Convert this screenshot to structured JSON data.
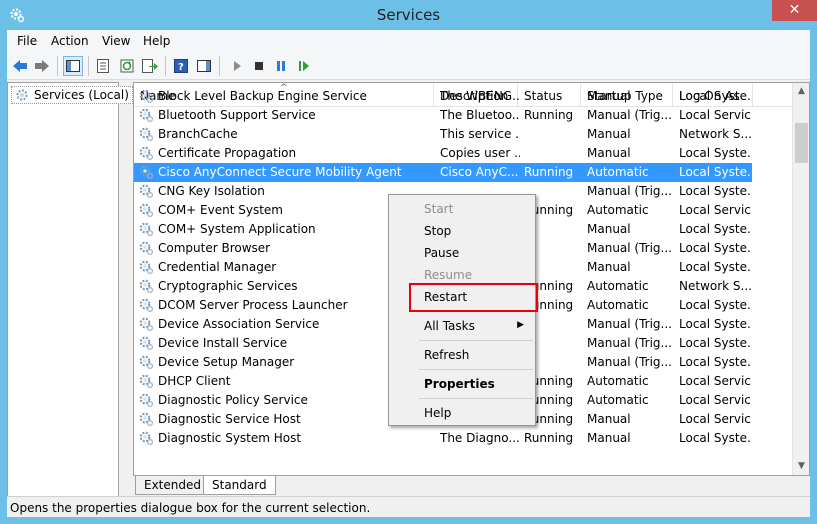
{
  "window": {
    "title": "Services",
    "close_glyph": "✕"
  },
  "menu": [
    "File",
    "Action",
    "View",
    "Help"
  ],
  "toolbar_icons": [
    "back-icon",
    "forward-icon",
    "console-tree-icon",
    "properties-icon",
    "refresh-icon",
    "export-icon",
    "help-icon",
    "show-pane-icon",
    "start-icon",
    "stop-icon",
    "pause-icon",
    "resume-icon"
  ],
  "tree": {
    "root_label": "Services (Local)"
  },
  "columns": {
    "name": "Name",
    "description": "Description",
    "status": "Status",
    "startup_type": "Startup Type",
    "log_on_as": "Log On As",
    "sort_glyph": "^"
  },
  "services": [
    {
      "name": "Block Level Backup Engine Service",
      "description": "The WBENG...",
      "status": "",
      "startup": "Manual",
      "logon": "Local Syste..."
    },
    {
      "name": "Bluetooth Support Service",
      "description": "The Bluetoo...",
      "status": "Running",
      "startup": "Manual (Trig...",
      "logon": "Local Service"
    },
    {
      "name": "BranchCache",
      "description": "This service ...",
      "status": "",
      "startup": "Manual",
      "logon": "Network S..."
    },
    {
      "name": "Certificate Propagation",
      "description": "Copies user ...",
      "status": "",
      "startup": "Manual",
      "logon": "Local Syste..."
    },
    {
      "name": "Cisco AnyConnect Secure Mobility Agent",
      "description": "Cisco AnyC...",
      "status": "Running",
      "startup": "Automatic",
      "logon": "Local Syste..."
    },
    {
      "name": "CNG Key Isolation",
      "description": "",
      "status": "",
      "startup": "Manual (Trig...",
      "logon": "Local Syste..."
    },
    {
      "name": "COM+ Event System",
      "description": "",
      "status": "Running",
      "startup": "Automatic",
      "logon": "Local Service"
    },
    {
      "name": "COM+ System Application",
      "description": "",
      "status": "",
      "startup": "Manual",
      "logon": "Local Syste..."
    },
    {
      "name": "Computer Browser",
      "description": "",
      "status": "",
      "startup": "Manual (Trig...",
      "logon": "Local Syste..."
    },
    {
      "name": "Credential Manager",
      "description": "",
      "status": "",
      "startup": "Manual",
      "logon": "Local Syste..."
    },
    {
      "name": "Cryptographic Services",
      "description": "",
      "status": "Running",
      "startup": "Automatic",
      "logon": "Network S..."
    },
    {
      "name": "DCOM Server Process Launcher",
      "description": "",
      "status": "Running",
      "startup": "Automatic",
      "logon": "Local Syste..."
    },
    {
      "name": "Device Association Service",
      "description": "",
      "status": "",
      "startup": "Manual (Trig...",
      "logon": "Local Syste..."
    },
    {
      "name": "Device Install Service",
      "description": "",
      "status": "",
      "startup": "Manual (Trig...",
      "logon": "Local Syste..."
    },
    {
      "name": "Device Setup Manager",
      "description": "",
      "status": "",
      "startup": "Manual (Trig...",
      "logon": "Local Syste..."
    },
    {
      "name": "DHCP Client",
      "description": "",
      "status": "Running",
      "startup": "Automatic",
      "logon": "Local Service"
    },
    {
      "name": "Diagnostic Policy Service",
      "description": "",
      "status": "Running",
      "startup": "Automatic",
      "logon": "Local Service"
    },
    {
      "name": "Diagnostic Service Host",
      "description": "The Diagno...",
      "status": "Running",
      "startup": "Manual",
      "logon": "Local Service"
    },
    {
      "name": "Diagnostic System Host",
      "description": "The Diagno...",
      "status": "Running",
      "startup": "Manual",
      "logon": "Local Syste..."
    }
  ],
  "context_menu": {
    "start": "Start",
    "stop": "Stop",
    "pause": "Pause",
    "resume": "Resume",
    "restart": "Restart",
    "all_tasks": "All Tasks",
    "submenu_glyph": "▶",
    "refresh": "Refresh",
    "properties": "Properties",
    "help": "Help"
  },
  "tabs": {
    "extended": "Extended",
    "standard": "Standard"
  },
  "status_bar": "Opens the properties dialogue box for the current selection.",
  "scroll_glyphs": {
    "up": "▲",
    "down": "▼"
  },
  "colors": {
    "selection": "#3399ff",
    "highlight_border": "#e8000d",
    "title_bar": "#6cbfe6",
    "close_button": "#c75050"
  }
}
